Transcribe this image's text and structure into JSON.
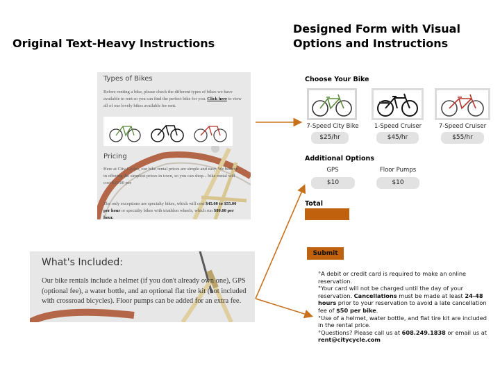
{
  "headings": {
    "left": "Original Text-Heavy Instructions",
    "right": "Designed Form with Visual Options and Instructions"
  },
  "original_top": {
    "types_title": "Types of Bikes",
    "types_text_1": "Before renting a bike, please check the different types of bikes we have available to rent so you can find the perfect bike for you.",
    "types_link": "Click here",
    "types_text_2": "to view all of our lovely bikes available for rent.",
    "pricing_title": "Pricing",
    "pricing_text": "Here at City Cycles, our bike rental prices are simple and easy. We believe in offering the simplest prices in town, so you can shop... bike rental will cost $25.00 per",
    "exceptions_text_1": "The only exceptions are specialty bikes, which will cost",
    "exceptions_bold_1": "$45.00 to $55.00 per hour",
    "exceptions_text_2": "or specialty bikes with triathlon wheels, which run",
    "exceptions_bold_2": "$80.00 per hour."
  },
  "original_bottom": {
    "title": "What's Included:",
    "text": "Our bike rentals include a helmet (if you don't already own one), GPS (optional fee), a water bottle, and an optional flat tire kit (not included with crossroad bicycles). Floor pumps can be added for an extra fee."
  },
  "form": {
    "choose_title": "Choose Your Bike",
    "bikes": [
      {
        "label": "7-Speed City Bike",
        "price": "$25/hr",
        "color": "#5a8a3c"
      },
      {
        "label": "1-Speed Cruiser",
        "price": "$45/hr",
        "color": "#1a1a1a"
      },
      {
        "label": "7-Speed Cruiser",
        "price": "$55/hr",
        "color": "#b8332a"
      }
    ],
    "options_title": "Additional Options",
    "options": [
      {
        "label": "GPS",
        "price": "$10"
      },
      {
        "label": "Floor Pumps",
        "price": "$10"
      }
    ],
    "total_label": "Total",
    "submit_label": "Submit",
    "notes": {
      "n1": "°A debit or credit card is required to make an online reservation.",
      "n2a": "°Your card will not be charged until the day of your reservation. ",
      "n2b": "Cancellations",
      "n2c": " must be made at least ",
      "n2d": "24-48 hours",
      "n2e": " prior to your reservation to avoid a late cancellation fee of ",
      "n2f": "$50 per bike",
      "n2g": ".",
      "n3": "°Use of a helmet, water bottle, and flat tire kit are included in the rental price.",
      "n4a": "°Questions? Please call us at ",
      "n4b": "608.249.1838",
      "n4c": " or email us at ",
      "n4d": "rent@citycycle.com"
    }
  },
  "colors": {
    "accent": "#c0620d",
    "arrow": "#c8711d",
    "panel_bg": "#e8e8e8",
    "pill_bg": "#e2e2e2"
  }
}
